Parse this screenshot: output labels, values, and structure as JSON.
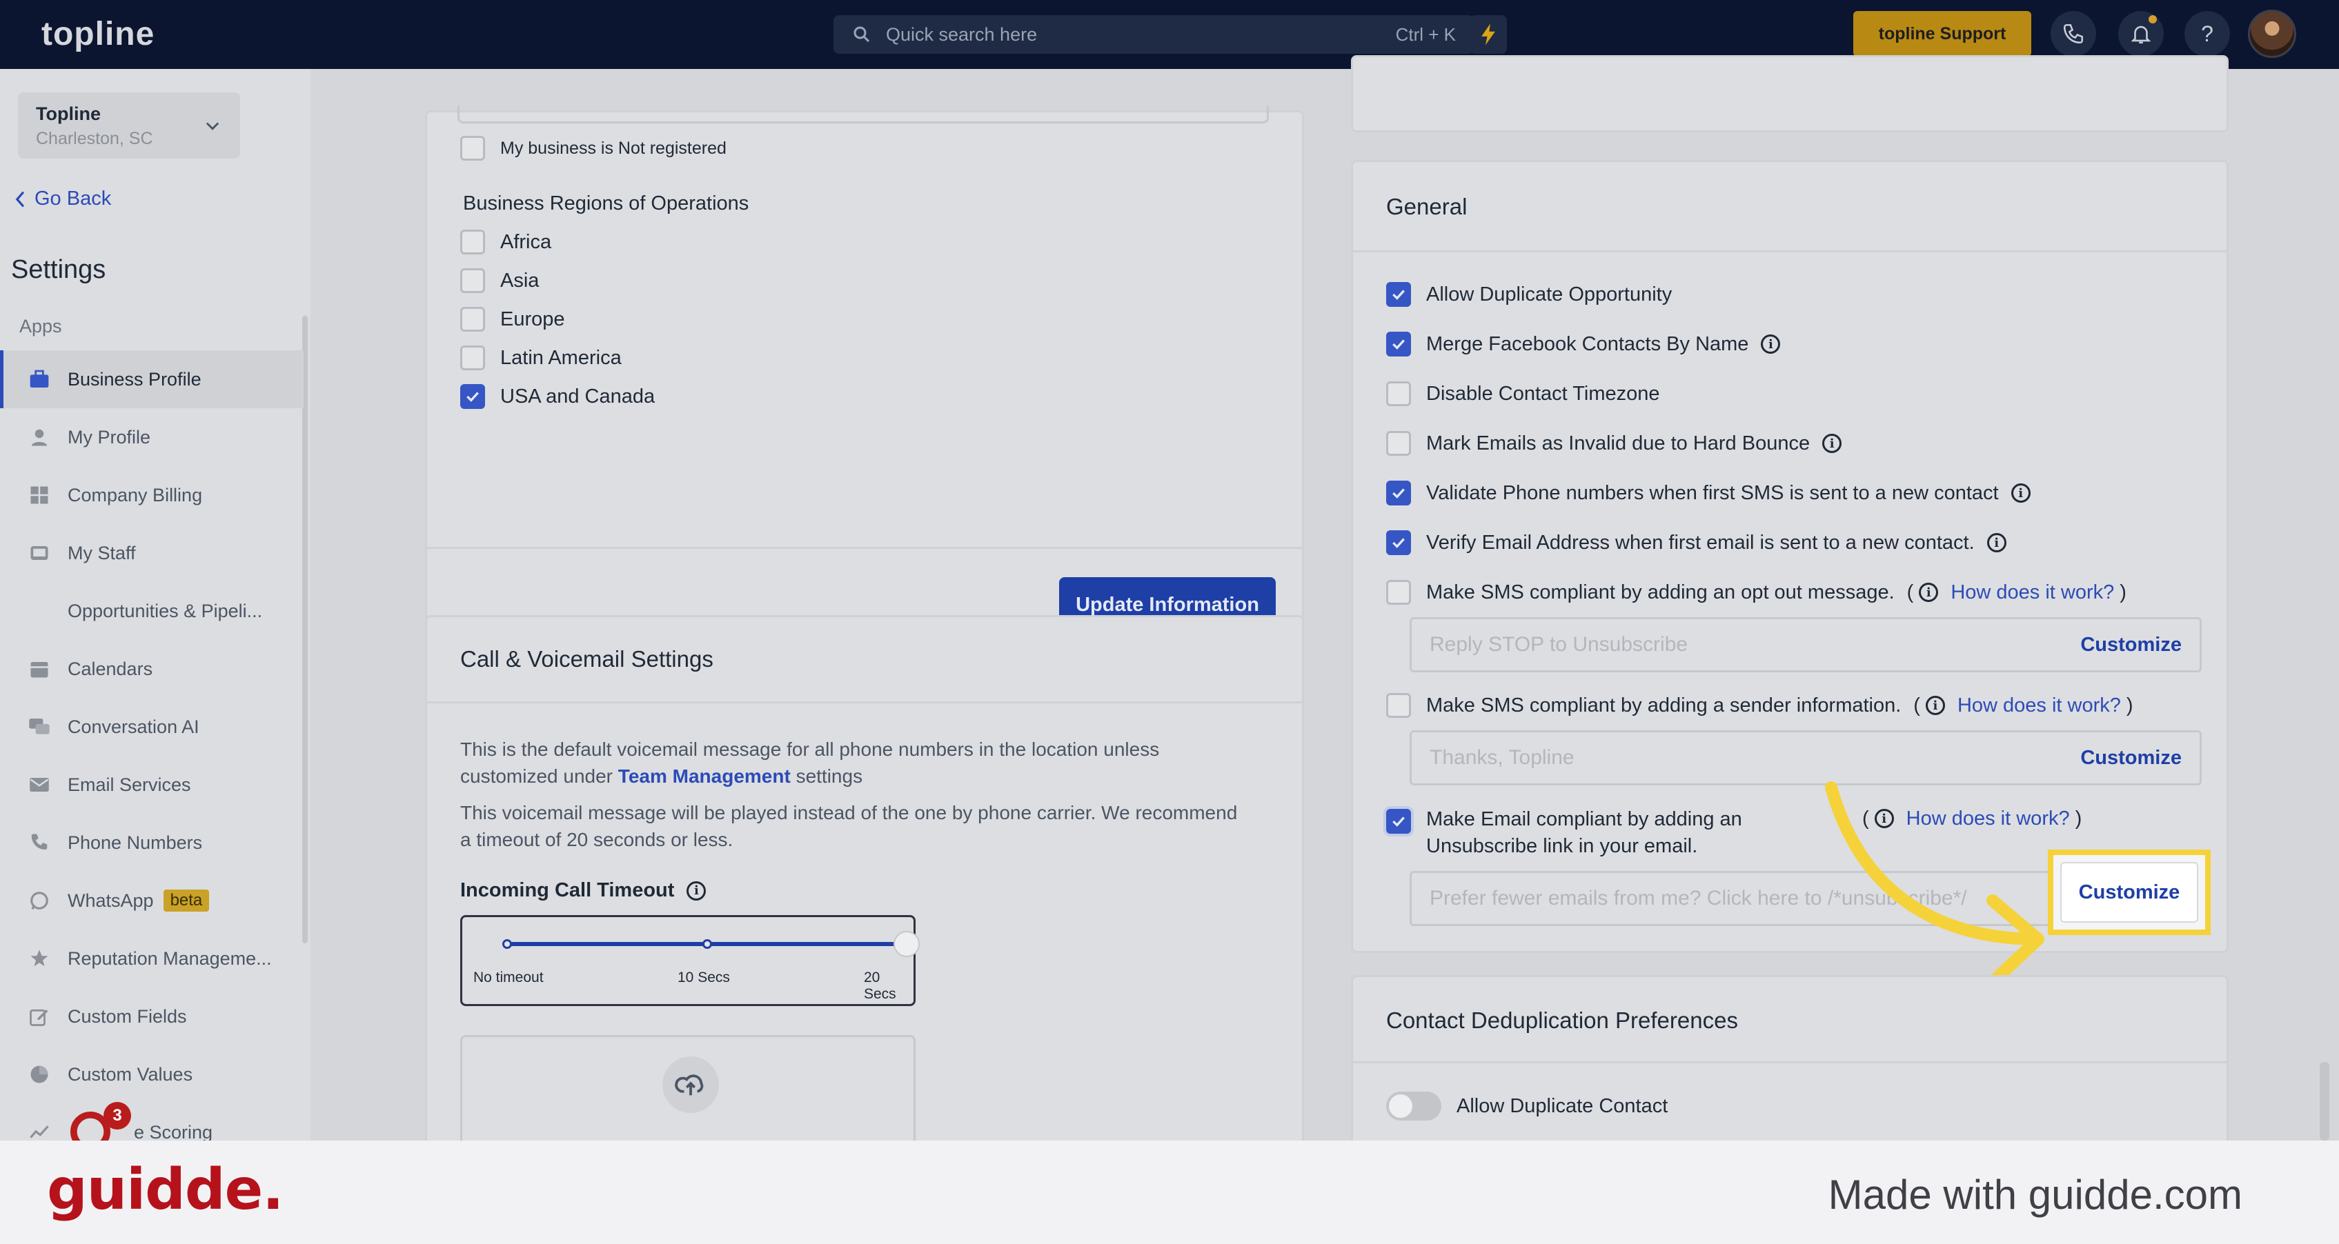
{
  "topbar": {
    "logo": "topline",
    "search_placeholder": "Quick search here",
    "search_shortcut": "Ctrl + K",
    "support_label": "topline Support"
  },
  "sidebar": {
    "location_name": "Topline",
    "location_city": "Charleston, SC",
    "go_back": "Go Back",
    "title": "Settings",
    "section": "Apps",
    "items": [
      {
        "label": "Business Profile",
        "icon": "briefcase-icon"
      },
      {
        "label": "My Profile",
        "icon": "person-icon"
      },
      {
        "label": "Company Billing",
        "icon": "grid-icon"
      },
      {
        "label": "My Staff",
        "icon": "staff-icon"
      },
      {
        "label": "Opportunities & Pipeli...",
        "icon": "none"
      },
      {
        "label": "Calendars",
        "icon": "calendar-icon"
      },
      {
        "label": "Conversation AI",
        "icon": "chat-icon"
      },
      {
        "label": "Email Services",
        "icon": "mail-icon"
      },
      {
        "label": "Phone Numbers",
        "icon": "phone-icon"
      },
      {
        "label": "WhatsApp",
        "icon": "whatsapp-icon",
        "badge": "beta"
      },
      {
        "label": "Reputation Manageme...",
        "icon": "star-icon"
      },
      {
        "label": "Custom Fields",
        "icon": "edit-icon"
      },
      {
        "label": "Custom Values",
        "icon": "pie-icon"
      },
      {
        "label": "e Scoring",
        "icon": "chart-icon"
      }
    ],
    "notification_count": "3"
  },
  "business": {
    "not_registered": "My business is Not registered",
    "regions_title": "Business Regions of Operations",
    "regions": [
      {
        "label": "Africa",
        "checked": false
      },
      {
        "label": "Asia",
        "checked": false
      },
      {
        "label": "Europe",
        "checked": false
      },
      {
        "label": "Latin America",
        "checked": false
      },
      {
        "label": "USA and Canada",
        "checked": true
      }
    ],
    "update_button": "Update Information"
  },
  "call": {
    "title": "Call & Voicemail Settings",
    "desc1_pre": "This is the default voicemail message for all phone numbers in the location unless customized under ",
    "desc1_link": "Team Management",
    "desc1_post": " settings",
    "desc2": "This voicemail message will be played instead of the one by phone carrier. We recommend a timeout of 20 seconds or less.",
    "timeout_label": "Incoming Call Timeout",
    "slider_labels": [
      "No timeout",
      "10 Secs",
      "20 Secs"
    ],
    "slider_value_fraction": 1.0
  },
  "general": {
    "title": "General",
    "options": [
      {
        "label": "Allow Duplicate Opportunity",
        "checked": true,
        "info": false
      },
      {
        "label": "Merge Facebook Contacts By Name",
        "checked": true,
        "info": true
      },
      {
        "label": "Disable Contact Timezone",
        "checked": false,
        "info": false
      },
      {
        "label": "Mark Emails as Invalid due to Hard Bounce",
        "checked": false,
        "info": true
      },
      {
        "label": "Validate Phone numbers when first SMS is sent to a new contact",
        "checked": true,
        "info": true
      },
      {
        "label": "Verify Email Address when first email is sent to a new contact.",
        "checked": true,
        "info": true
      }
    ],
    "sms_optout_label": "Make SMS compliant by adding an opt out message.",
    "sms_optout_placeholder": "Reply STOP to Unsubscribe",
    "sms_sender_label": "Make SMS compliant by adding a sender information.",
    "sms_sender_placeholder": "Thanks, Topline",
    "email_unsub_label": "Make Email compliant by adding an Unsubscribe link in your email.",
    "email_unsub_placeholder": "Prefer fewer emails from me? Click here to /*unsubscribe*/",
    "how_link": "How does it work?",
    "customize": "Customize"
  },
  "dedup": {
    "title": "Contact Deduplication Preferences",
    "allow_duplicate": "Allow Duplicate Contact"
  },
  "footer": {
    "logo": "guidde.",
    "made_with": "Made with guidde.com"
  },
  "colors": {
    "highlight": "#f5d23a",
    "primary": "#1e3fa6"
  }
}
